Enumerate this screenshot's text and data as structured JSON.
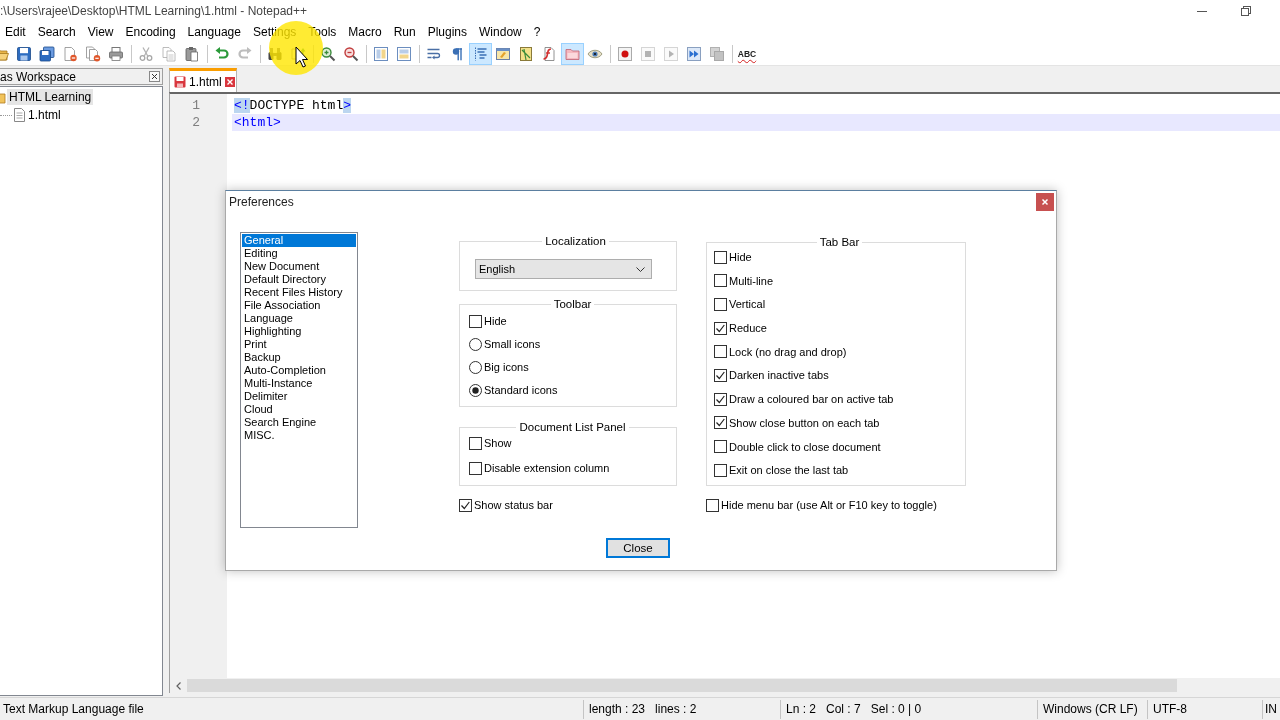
{
  "window": {
    "title": ":\\Users\\rajee\\Desktop\\HTML Learning\\1.html - Notepad++"
  },
  "menu_bar": [
    "Edit",
    "Search",
    "View",
    "Encoding",
    "Language",
    "Settings",
    "Tools",
    "Macro",
    "Run",
    "Plugins",
    "Window",
    "?"
  ],
  "toolbar": [
    {
      "kind": "open",
      "pressed": false,
      "disabled": false
    },
    {
      "kind": "save",
      "pressed": false,
      "disabled": false
    },
    {
      "kind": "save-all",
      "pressed": false,
      "disabled": false
    },
    {
      "kind": "close",
      "pressed": false,
      "disabled": false
    },
    {
      "kind": "close-all",
      "pressed": false,
      "disabled": false
    },
    {
      "kind": "print",
      "pressed": false,
      "disabled": false
    },
    {
      "kind": "separator"
    },
    {
      "kind": "cut",
      "pressed": false,
      "disabled": true
    },
    {
      "kind": "copy",
      "pressed": false,
      "disabled": true
    },
    {
      "kind": "paste",
      "pressed": false,
      "disabled": false
    },
    {
      "kind": "separator"
    },
    {
      "kind": "undo",
      "pressed": false,
      "disabled": false
    },
    {
      "kind": "redo",
      "pressed": false,
      "disabled": true
    },
    {
      "kind": "separator"
    },
    {
      "kind": "find",
      "pressed": false,
      "disabled": false
    },
    {
      "kind": "replace",
      "pressed": false,
      "disabled": false
    },
    {
      "kind": "separator"
    },
    {
      "kind": "zoom-in",
      "pressed": false,
      "disabled": false
    },
    {
      "kind": "zoom-out",
      "pressed": false,
      "disabled": false
    },
    {
      "kind": "separator"
    },
    {
      "kind": "sync-vertical",
      "pressed": false,
      "disabled": false
    },
    {
      "kind": "sync-horizontal",
      "pressed": false,
      "disabled": false
    },
    {
      "kind": "separator"
    },
    {
      "kind": "word-wrap",
      "pressed": false,
      "disabled": false
    },
    {
      "kind": "all-characters",
      "pressed": false,
      "disabled": false
    },
    {
      "kind": "indent-guide",
      "pressed": true,
      "disabled": false
    },
    {
      "kind": "user-language",
      "pressed": false,
      "disabled": false
    },
    {
      "kind": "document-map",
      "pressed": false,
      "disabled": false
    },
    {
      "kind": "function-list",
      "pressed": false,
      "disabled": false
    },
    {
      "kind": "folder-workspace",
      "pressed": true,
      "disabled": false
    },
    {
      "kind": "monitoring",
      "pressed": false,
      "disabled": false
    },
    {
      "kind": "separator"
    },
    {
      "kind": "record",
      "pressed": false,
      "disabled": false
    },
    {
      "kind": "stop",
      "pressed": false,
      "disabled": true
    },
    {
      "kind": "play",
      "pressed": false,
      "disabled": true
    },
    {
      "kind": "play-multiple",
      "pressed": false,
      "disabled": false
    },
    {
      "kind": "save-macro",
      "pressed": false,
      "disabled": true
    },
    {
      "kind": "separator"
    },
    {
      "kind": "spell-check",
      "label": "ABC",
      "pressed": false,
      "disabled": false
    }
  ],
  "sidebar": {
    "title": "as Workspace",
    "tree": [
      {
        "label": "HTML Learning",
        "selected": true,
        "children": [
          {
            "label": "1.html",
            "selected": false
          }
        ]
      }
    ]
  },
  "tabs": [
    {
      "label": "1.html",
      "selected": true,
      "modified": true
    }
  ],
  "editor": {
    "lines": [
      {
        "number": "1",
        "current": false,
        "tokens": [
          {
            "text": "<!",
            "kind": "tag",
            "matched": true
          },
          {
            "text": "DOCTYPE html",
            "kind": "plain",
            "matched": false
          },
          {
            "text": ">",
            "kind": "tag",
            "matched": true
          }
        ]
      },
      {
        "number": "2",
        "current": true,
        "tokens": [
          {
            "text": "<html>",
            "kind": "tag",
            "matched": false
          }
        ]
      }
    ]
  },
  "status_bar": [
    [
      "Text Markup Language file"
    ],
    [
      "length : 23",
      "lines : 2"
    ],
    [
      "Ln : 2",
      "Col : 7",
      "Sel : 0 | 0"
    ],
    [
      "Windows (CR LF)"
    ],
    [
      "UTF-8"
    ],
    [
      "IN"
    ]
  ],
  "preferences": {
    "title": "Preferences",
    "categories": [
      {
        "label": "General",
        "selected": true
      },
      {
        "label": "Editing",
        "selected": false
      },
      {
        "label": "New Document",
        "selected": false
      },
      {
        "label": "Default Directory",
        "selected": false
      },
      {
        "label": "Recent Files History",
        "selected": false
      },
      {
        "label": "File Association",
        "selected": false
      },
      {
        "label": "Language",
        "selected": false
      },
      {
        "label": "Highlighting",
        "selected": false
      },
      {
        "label": "Print",
        "selected": false
      },
      {
        "label": "Backup",
        "selected": false
      },
      {
        "label": "Auto-Completion",
        "selected": false
      },
      {
        "label": "Multi-Instance",
        "selected": false
      },
      {
        "label": "Delimiter",
        "selected": false
      },
      {
        "label": "Cloud",
        "selected": false
      },
      {
        "label": "Search Engine",
        "selected": false
      },
      {
        "label": "MISC.",
        "selected": false
      }
    ],
    "localization": {
      "title": "Localization",
      "value": "English"
    },
    "toolbar": {
      "title": "Toolbar",
      "options": [
        {
          "kind": "checkbox",
          "label": "Hide",
          "checked": false
        },
        {
          "kind": "radio",
          "label": "Small icons",
          "selected": false
        },
        {
          "kind": "radio",
          "label": "Big icons",
          "selected": false
        },
        {
          "kind": "radio",
          "label": "Standard icons",
          "selected": true
        }
      ]
    },
    "document_list_panel": {
      "title": "Document List Panel",
      "options": [
        {
          "label": "Show",
          "checked": false
        },
        {
          "label": "Disable extension column",
          "checked": false
        }
      ]
    },
    "show_status_bar": {
      "label": "Show status bar",
      "checked": true
    },
    "tab_bar": {
      "title": "Tab Bar",
      "options": [
        {
          "label": "Hide",
          "checked": false
        },
        {
          "label": "Multi-line",
          "checked": false
        },
        {
          "label": "Vertical",
          "checked": false
        },
        {
          "label": "Reduce",
          "checked": true
        },
        {
          "label": "Lock (no drag and drop)",
          "checked": false
        },
        {
          "label": "Darken inactive tabs",
          "checked": true
        },
        {
          "label": "Draw a coloured bar on active tab",
          "checked": true
        },
        {
          "label": "Show close button on each tab",
          "checked": true
        },
        {
          "label": "Double click to close document",
          "checked": false
        },
        {
          "label": "Exit on close the last tab",
          "checked": false
        }
      ]
    },
    "hide_menu_bar": {
      "label": "Hide menu bar (use Alt or F10 key to toggle)",
      "checked": false
    },
    "buttons": [
      "Close"
    ]
  }
}
